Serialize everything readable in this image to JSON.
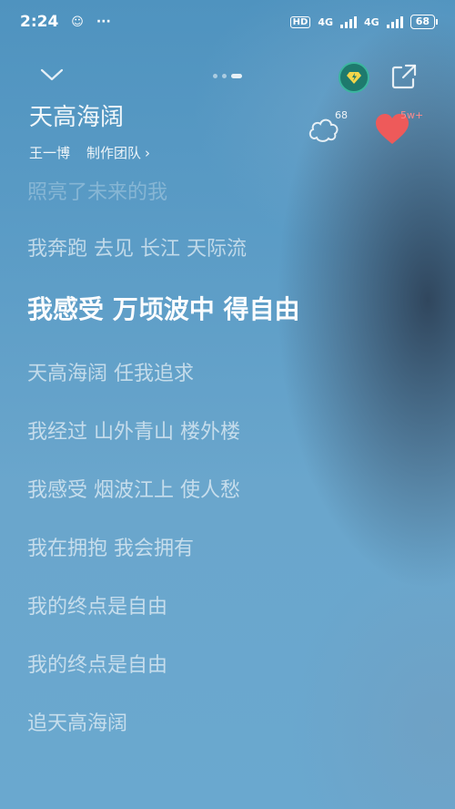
{
  "status_bar": {
    "time": "2:24",
    "dots": "···",
    "hd_label": "HD",
    "network_1": "4G",
    "network_2": "4G",
    "battery": "68"
  },
  "player": {
    "song_title": "天高海阔",
    "artist": "王一博",
    "team_label": "制作团队",
    "comment_count": "68",
    "like_count": "5w+",
    "accent_color": "#ee5a5a",
    "vip_color": "#1e7a6d"
  },
  "lyrics": {
    "lines": [
      "照亮了未来的我",
      "我奔跑 去见 长江 天际流",
      "我感受 万顷波中 得自由",
      "天高海阔 任我追求",
      "我经过 山外青山 楼外楼",
      "我感受 烟波江上 使人愁",
      "我在拥抱 我会拥有",
      "我的终点是自由",
      "我的终点是自由",
      "追天高海阔"
    ],
    "current_index": 2
  }
}
